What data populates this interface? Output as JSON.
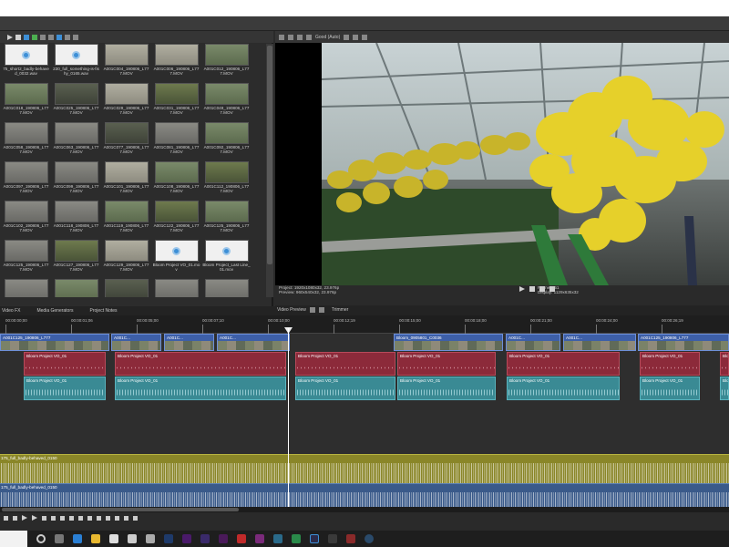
{
  "media_thumbnails": [
    {
      "label": "75_short2_badly-behaved_0032.wav",
      "kind": "audio"
    },
    {
      "label": "230_full_something-is-fishy_0165.wav",
      "kind": "audio"
    },
    {
      "label": "A001C004_190806_L777.MOV",
      "kind": "video",
      "tone": "light"
    },
    {
      "label": "A001C006_190806_L777.MOV",
      "kind": "video",
      "tone": "light"
    },
    {
      "label": "A001C012_190806_L777.MOV",
      "kind": "video",
      "tone": "green"
    },
    {
      "label": "A001C018_190806_L777.MOV",
      "kind": "video",
      "tone": "green"
    },
    {
      "label": "A001C025_190806_L777.MOV",
      "kind": "video",
      "tone": "dark"
    },
    {
      "label": "A001C029_190806_L777.MOV",
      "kind": "video",
      "tone": "light"
    },
    {
      "label": "A001C031_190806_L777.MOV",
      "kind": "video",
      "tone": "olive"
    },
    {
      "label": "A001C049_190806_L777.MOV",
      "kind": "video",
      "tone": "green"
    },
    {
      "label": "A001C058_190806_L777.MOV",
      "kind": "video",
      "tone": "gray"
    },
    {
      "label": "A001C063_190806_L777.MOV",
      "kind": "video",
      "tone": "gray"
    },
    {
      "label": "A001C077_190806_L777.MOV",
      "kind": "video",
      "tone": "dark"
    },
    {
      "label": "A001C081_190806_L777.MOV",
      "kind": "video",
      "tone": "gray"
    },
    {
      "label": "A001C092_190806_L777.MOV",
      "kind": "video",
      "tone": "green"
    },
    {
      "label": "A001C097_190806_L777.MOV",
      "kind": "video",
      "tone": "gray"
    },
    {
      "label": "A001C099_190806_L777.MOV",
      "kind": "video",
      "tone": "gray"
    },
    {
      "label": "A001C101_190806_L777.MOV",
      "kind": "video",
      "tone": "light"
    },
    {
      "label": "A001C108_190806_L777.MOV",
      "kind": "video",
      "tone": "green"
    },
    {
      "label": "A001C112_190806_L777.MOV",
      "kind": "video",
      "tone": "olive"
    },
    {
      "label": "A001C102_190806_L777.MOV",
      "kind": "video",
      "tone": "gray"
    },
    {
      "label": "A001C118_190806_L777.MOV",
      "kind": "video",
      "tone": "gray"
    },
    {
      "label": "A001C119_190806_L777.MOV",
      "kind": "video",
      "tone": "green"
    },
    {
      "label": "A001C122_190806_L777.MOV",
      "kind": "video",
      "tone": "olive"
    },
    {
      "label": "A001C125_190806_L777.MOV",
      "kind": "video",
      "tone": "green"
    },
    {
      "label": "A001C125_190806_L777.MOV",
      "kind": "video",
      "tone": "gray"
    },
    {
      "label": "A001C127_190806_L777.MOV",
      "kind": "video",
      "tone": "olive"
    },
    {
      "label": "A001C129_190806_L777.MOV",
      "kind": "video",
      "tone": "light"
    },
    {
      "label": "Bloom Project VO_01.mov",
      "kind": "audio"
    },
    {
      "label": "Bloom Project_Last Line_01.mov",
      "kind": "audio"
    },
    {
      "label": "",
      "kind": "video",
      "tone": "gray"
    },
    {
      "label": "",
      "kind": "video",
      "tone": "green"
    },
    {
      "label": "",
      "kind": "video",
      "tone": "dark"
    },
    {
      "label": "",
      "kind": "video",
      "tone": "gray"
    },
    {
      "label": "",
      "kind": "video",
      "tone": "gray"
    }
  ],
  "left_tabs": [
    "Video FX",
    "Media Generators",
    "Project Notes"
  ],
  "preview": {
    "quality": "Good (Auto)",
    "project_line": "Project:  1920x1080x32, 23.976p",
    "preview_line": "Preview:  960x540x32, 23.976p",
    "frame_line": "Frame:   151",
    "display_line": "Display:  1129x635x32"
  },
  "right_tabs": [
    "Video Preview",
    "Trimmer"
  ],
  "ruler_ticks": [
    "00:00:00;00",
    "00:00:01;06",
    "00:00:05;00",
    "00:00:07;10",
    "00:00:10;00",
    "00:00:12;19",
    "00:00:15;00",
    "00:00:18;00",
    "00:00:21;00",
    "00:00:24;00",
    "00:00:26;19"
  ],
  "video_clips": [
    {
      "label": "A001C125_190806_L777"
    },
    {
      "label": "A001C..."
    },
    {
      "label": "A001C..."
    },
    {
      "label": "A001C..."
    },
    {
      "label": "Bloom_0905801_C0036"
    },
    {
      "label": "A001C..."
    },
    {
      "label": "A001C..."
    },
    {
      "label": "A001C125_190806_L777"
    }
  ],
  "vo_clip_label": "Bloom Project VO_01",
  "music_track_label": "175_full_badly-behaved_0150",
  "music_track_label_2": "175_full_badly-behaved_0150"
}
